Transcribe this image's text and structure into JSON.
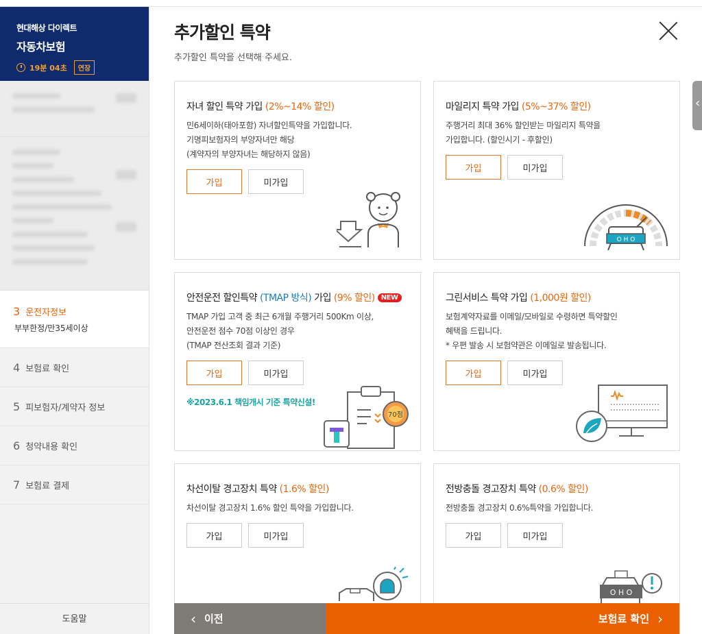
{
  "sidebar": {
    "company": "현대해상 다이렉트",
    "product": "자동차보험",
    "timer": "19분 04초",
    "extend_label": "연장",
    "active_step": {
      "num": "3",
      "label": "운전자정보",
      "sub": "부부한정/만35세이상"
    },
    "steps": [
      {
        "num": "4",
        "label": "보험료 확인"
      },
      {
        "num": "5",
        "label": "피보험자/계약자 정보"
      },
      {
        "num": "6",
        "label": "청약내용 확인"
      },
      {
        "num": "7",
        "label": "보험료 결제"
      }
    ],
    "help_label": "도움말"
  },
  "main": {
    "title": "추가할인 특약",
    "subtitle": "추가할인 특약을 선택해 주세요.",
    "cards": [
      {
        "title": "자녀 할인 특약 가입 ",
        "discount": "(2%~14% 할인)",
        "desc": "민6세이하(태아포함) 자녀할인특약을 가입합니다.\n기명피보험자의 부양자녀만 해당\n(계약자의 부양자녀는 해당하지 않음)",
        "join": "가입",
        "decline": "미가입",
        "selected": "join"
      },
      {
        "title": "마일리지 특약 가입 ",
        "discount": "(5%~37% 할인)",
        "desc": "주행거리 최대 36% 할인받는 마일리지 특약을\n가입합니다. (할인시기 - 후할인)",
        "join": "가입",
        "decline": "미가입",
        "selected": "join"
      },
      {
        "title": "안전운전 할인특약 ",
        "tmap": "(TMAP 방식)",
        "title_suffix": " 가입 ",
        "discount": "(9% 할인)",
        "badge": "NEW",
        "desc": "TMAP 가입 고객 중 최근 6개월 주행거리 500Km 이상,\n안전운전 점수 70점 이상인 경우\n(TMAP 전산조회 결과 기준)",
        "join": "가입",
        "decline": "미가입",
        "selected": "join",
        "note": "※2023.6.1 책임개시 기준 특약신설!",
        "score": "70점"
      },
      {
        "title": "그린서비스 특약 가입 ",
        "discount": "(1,000원 할인)",
        "desc": "보험계약자료를 이메일/모바일로 수령하면 특약할인\n혜택을 드립니다.\n* 우편 발송 시 보험약관은 이메일로 발송됩니다.",
        "join": "가입",
        "decline": "미가입",
        "selected": "join"
      },
      {
        "title": "차선이탈 경고장치 특약 ",
        "discount": "(1.6% 할인)",
        "desc": "차선이탈 경고장치 1.6% 할인 특약을 가입합니다.",
        "join": "가입",
        "decline": "미가입",
        "selected": "none"
      },
      {
        "title": "전방충돌 경고장치 특약 ",
        "discount": "(0.6% 할인)",
        "desc": "전방충돌 경고장치 0.6%특약을 가입합니다.",
        "join": "가입",
        "decline": "미가입",
        "selected": "none"
      }
    ]
  },
  "nav": {
    "prev": "이전",
    "next": "보험료 확인"
  },
  "colors": {
    "accent": "#ea5f00",
    "navy": "#0f2b6d",
    "teal": "#19a4a4"
  }
}
